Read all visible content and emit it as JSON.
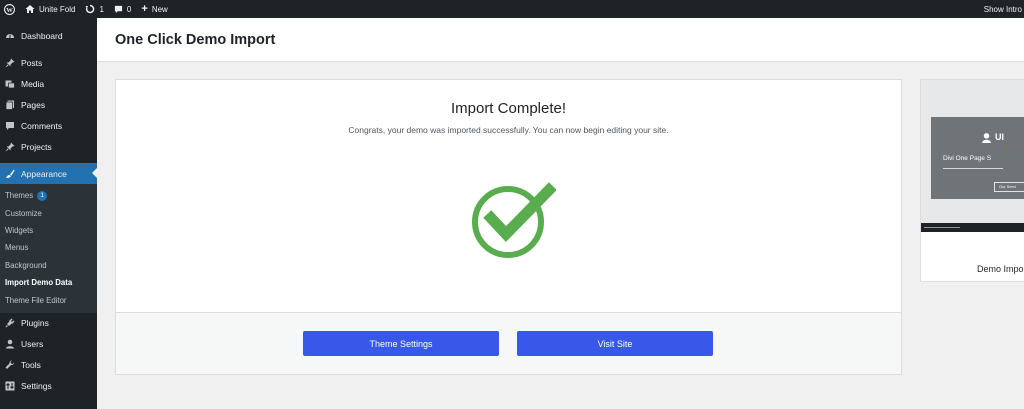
{
  "adminbar": {
    "site_name": "Unite Fold",
    "updates_count": "1",
    "comments_count": "0",
    "new_label": "New",
    "right_text": "Show Intro"
  },
  "sidebar": {
    "items_top": [
      {
        "label": "Dashboard",
        "icon": "dashboard-icon"
      },
      {
        "label": "Posts",
        "icon": "pin-icon"
      },
      {
        "label": "Media",
        "icon": "media-icon"
      },
      {
        "label": "Pages",
        "icon": "pages-icon"
      },
      {
        "label": "Comments",
        "icon": "comment-icon"
      },
      {
        "label": "Projects",
        "icon": "pin-icon"
      }
    ],
    "active": {
      "label": "Appearance",
      "icon": "paintbrush-icon"
    },
    "submenu": [
      {
        "label": "Themes",
        "badge": "1"
      },
      {
        "label": "Customize"
      },
      {
        "label": "Widgets"
      },
      {
        "label": "Menus"
      },
      {
        "label": "Background"
      },
      {
        "label": "Import Demo Data",
        "current": true
      },
      {
        "label": "Theme File Editor"
      }
    ],
    "items_bottom": [
      {
        "label": "Plugins",
        "icon": "plug-icon"
      },
      {
        "label": "Users",
        "icon": "users-icon"
      },
      {
        "label": "Tools",
        "icon": "wrench-icon"
      },
      {
        "label": "Settings",
        "icon": "settings-icon"
      }
    ]
  },
  "page": {
    "title": "One Click Demo Import"
  },
  "panel": {
    "heading": "Import Complete!",
    "message": "Congrats, your demo was imported successfully. You can now begin editing your site.",
    "check_color": "#5aad4e",
    "buttons": {
      "theme_settings": "Theme Settings",
      "visit_site": "Visit Site"
    },
    "button_color": "#3858e9"
  },
  "preview_card": {
    "label": "Demo Impo",
    "thumb_logo": "UI",
    "thumb_title": "Divi One Page S",
    "thumb_button": "Our Servi"
  }
}
